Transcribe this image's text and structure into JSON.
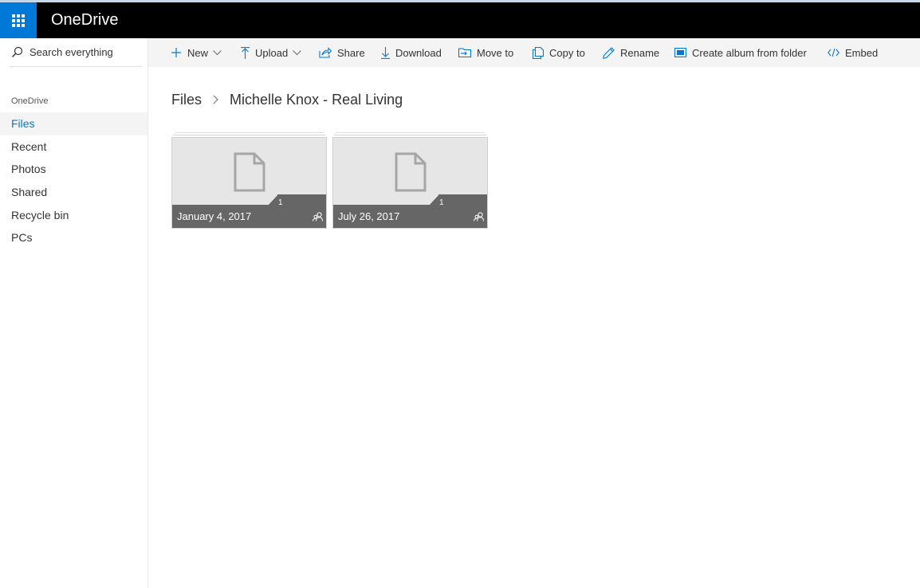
{
  "app": {
    "title": "OneDrive",
    "brand_color": "#0078d7"
  },
  "search": {
    "placeholder": "Search everything",
    "icon": "search-icon"
  },
  "nav": {
    "header": "OneDrive",
    "items": [
      {
        "label": "Files",
        "active": true
      },
      {
        "label": "Recent",
        "active": false
      },
      {
        "label": "Photos",
        "active": false
      },
      {
        "label": "Shared",
        "active": false
      },
      {
        "label": "Recycle bin",
        "active": false
      },
      {
        "label": "PCs",
        "active": false
      }
    ]
  },
  "commands": {
    "new": {
      "label": "New",
      "icon": "plus-icon"
    },
    "upload": {
      "label": "Upload",
      "icon": "upload-icon"
    },
    "share": {
      "label": "Share",
      "icon": "share-icon"
    },
    "download": {
      "label": "Download",
      "icon": "download-icon"
    },
    "move_to": {
      "label": "Move to",
      "icon": "move-to-icon"
    },
    "copy_to": {
      "label": "Copy to",
      "icon": "copy-icon"
    },
    "rename": {
      "label": "Rename",
      "icon": "pencil-icon"
    },
    "create_album": {
      "label": "Create album from folder",
      "icon": "album-icon"
    },
    "embed": {
      "label": "Embed",
      "icon": "embed-icon"
    }
  },
  "breadcrumb": {
    "root": "Files",
    "current": "Michelle Knox - Real Living"
  },
  "folders": [
    {
      "name": "January 4, 2017",
      "count": "1",
      "shared": true
    },
    {
      "name": "July 26, 2017",
      "count": "1",
      "shared": true
    }
  ]
}
